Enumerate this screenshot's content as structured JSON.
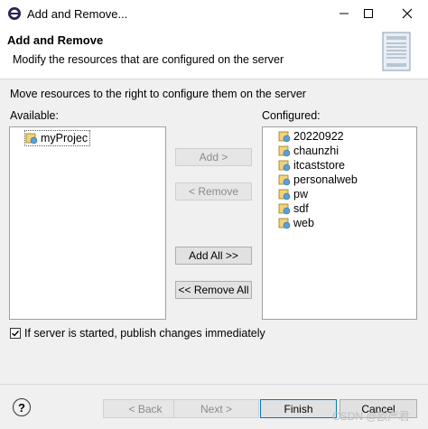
{
  "window": {
    "title": "Add and Remove...",
    "icons": [
      "eclipse-icon",
      "minimize-icon",
      "maximize-icon",
      "close-icon"
    ]
  },
  "header": {
    "title": "Add and Remove",
    "description": "Modify the resources that are configured on the server"
  },
  "instruction": "Move resources to the right to configure them on the server",
  "available": {
    "label": "Available:",
    "items": [
      "myProjec"
    ]
  },
  "configured": {
    "label": "Configured:",
    "items": [
      "20220922",
      "chaunzhi",
      "itcaststore",
      "personalweb",
      "pw",
      "sdf",
      "web"
    ]
  },
  "buttons": {
    "add": "Add >",
    "remove": "< Remove",
    "add_all": "Add All >>",
    "remove_all": "<< Remove All"
  },
  "publish_checkbox": {
    "label": "If server is started, publish changes immediately",
    "checked": true
  },
  "footer": {
    "help": "?",
    "back": "< Back",
    "next": "Next >",
    "finish": "Finish",
    "cancel": "Cancel"
  },
  "watermark": "CSDN @欧严君",
  "colors": {
    "accent": "#0078d7",
    "list_bg": "#ffffff",
    "dialog_bg": "#f0f0f0"
  }
}
